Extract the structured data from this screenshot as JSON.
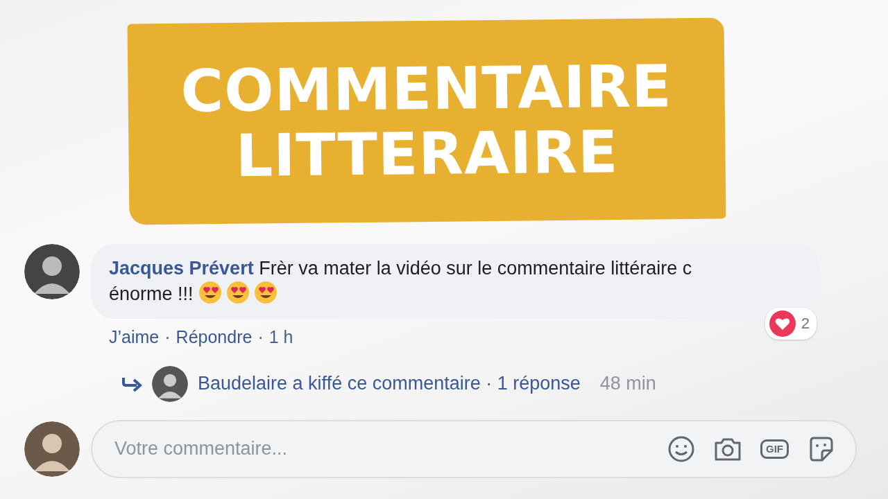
{
  "title": {
    "lines": [
      "COMMENTAIRE",
      "LITTERAIRE"
    ]
  },
  "comment": {
    "author": "Jacques Prévert",
    "text": "Frèr va mater la vidéo sur le commentaire littéraire c énorme !!!",
    "emojis": [
      {
        "kind": "heart-eyes"
      },
      {
        "kind": "heart-eyes"
      },
      {
        "kind": "heart-eyes"
      }
    ],
    "reaction_count": "2",
    "separator": "·",
    "actions": [
      {
        "label": "J’aime",
        "kind": "link"
      },
      {
        "label": "Répondre",
        "kind": "link"
      },
      {
        "label": "1 h",
        "kind": "time"
      }
    ]
  },
  "reply": {
    "text": "Baudelaire a kiffé ce commentaire · 1 réponse",
    "time": "48 min"
  },
  "composer": {
    "placeholder": "Votre commentaire...",
    "gif_label": "GIF"
  }
}
